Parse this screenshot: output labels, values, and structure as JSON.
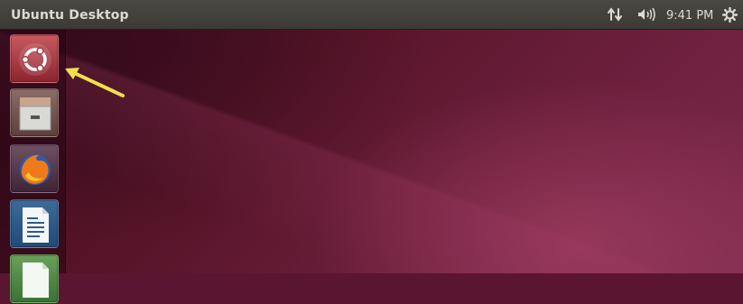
{
  "topbar": {
    "title": "Ubuntu Desktop",
    "clock": "9:41 PM",
    "indicators": [
      "network-icon",
      "volume-icon",
      "gear-icon"
    ]
  },
  "launcher": {
    "items": [
      {
        "name": "dash-home",
        "icon": "ubuntu-logo-icon"
      },
      {
        "name": "files",
        "icon": "file-cabinet-icon"
      },
      {
        "name": "firefox",
        "icon": "firefox-icon"
      },
      {
        "name": "libreoffice-writer",
        "icon": "document-icon"
      },
      {
        "name": "libreoffice-calc",
        "icon": "spreadsheet-icon"
      }
    ]
  },
  "annotation": {
    "icon": "yellow-arrow-icon",
    "color": "#f3e04a"
  },
  "colors": {
    "topbar": "#3b3a36",
    "desktop": "#5a1530",
    "dash": "#a83f48"
  }
}
